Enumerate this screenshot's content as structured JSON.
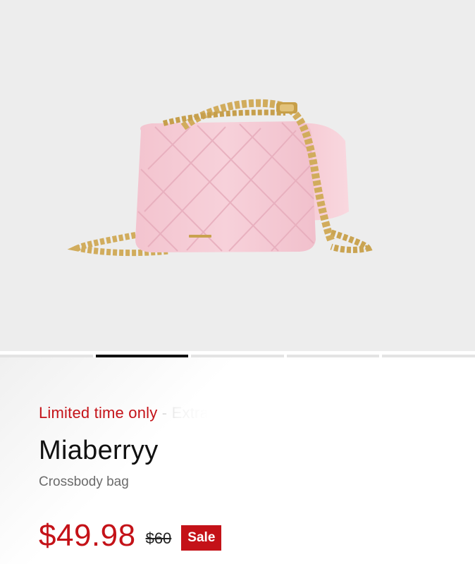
{
  "product": {
    "image_alt": "Pink quilted crossbody bag with gold chain strap",
    "promo_highlight": "Limited time only",
    "promo_rest": " - Extra",
    "name": "Miaberryy",
    "category": "Crossbody bag",
    "price": "$49.98",
    "original_price": "$60",
    "badge": "Sale"
  },
  "gallery": {
    "slide_count": 5,
    "active_index": 1
  },
  "colors": {
    "sale_red": "#c41218",
    "bag_pink": "#f6ccd6",
    "chain_gold": "#d1ac5c",
    "background": "#ededed"
  }
}
